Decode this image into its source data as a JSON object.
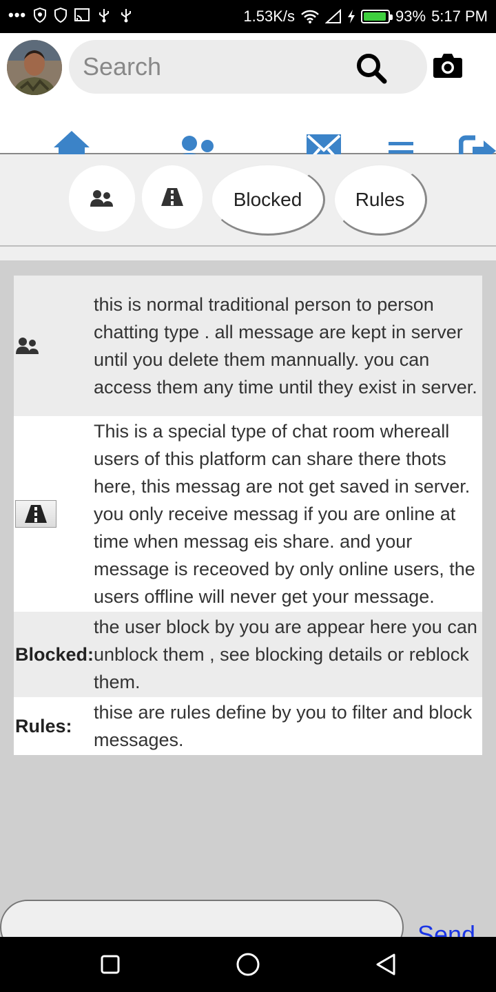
{
  "status_bar": {
    "network_speed": "1.53K/s",
    "battery_percent": "93%",
    "battery_level": 0.93,
    "time": "5:17 PM",
    "icons": [
      "more-dots-icon",
      "shield-icon",
      "shield-outline-icon",
      "cast-icon",
      "usb-icon",
      "usb-icon",
      "wifi-icon",
      "signal-icon",
      "charging-bolt-icon",
      "battery-icon"
    ]
  },
  "header": {
    "search_placeholder": "Search",
    "nav_icons": [
      "home-icon",
      "users-icon",
      "mail-icon",
      "menu-icon",
      "logout-icon"
    ]
  },
  "tabs": [
    {
      "icon": "contacts-icon",
      "label": ""
    },
    {
      "icon": "road-icon",
      "label": ""
    },
    {
      "icon": "",
      "label": "Blocked"
    },
    {
      "icon": "",
      "label": "Rules"
    }
  ],
  "info_rows": [
    {
      "icon": "contacts-icon",
      "label": "",
      "text": "this is normal traditional person to person chatting type . all message are kept in server until you delete them mannually. you can access them any time until they exist in server."
    },
    {
      "icon": "road-icon",
      "label": "",
      "text": "This is a special type of chat room whereall users of this platform can share there thots here, this messag are not get saved in server. you only receive messag if you are online at time when messag eis share. and your message is receoved by only online users, the users offline will never get your message."
    },
    {
      "icon": "",
      "label": "Blocked:",
      "text": "the user block by you are appear here you can unblock them , see blocking details or reblock them."
    },
    {
      "icon": "",
      "label": "Rules:",
      "text": "thise are rules define by you to filter and block messages."
    }
  ],
  "composer": {
    "send_label": "Send"
  },
  "colors": {
    "accent_blue": "#3b83c8",
    "send_blue": "#1a35e6",
    "battery_green": "#3ecf3e"
  }
}
